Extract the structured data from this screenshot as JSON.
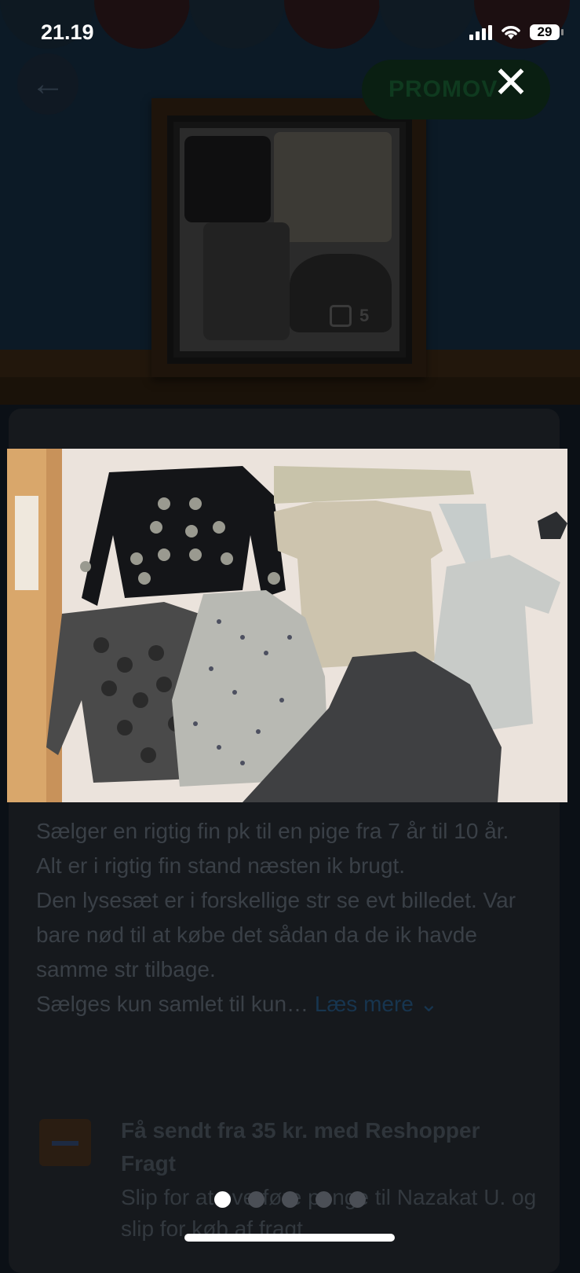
{
  "status_bar": {
    "time": "21.19",
    "battery": "29"
  },
  "header": {
    "back_icon": "arrow-left-icon",
    "promo_label": "PROMOV",
    "close_icon": "close-icon"
  },
  "listing": {
    "image_count": "5",
    "description_lines": [
      "Sælger en rigtig fin pk til en pige fra 7 år til 10 år.",
      "Alt er i rigtig fin stand næsten ik brugt.",
      "Den lysesæt er i forskellige str se evt billedet. Var bare nød til at købe det sådan da de ik havde samme str tilbage.",
      "Sælges kun samlet til kun…"
    ],
    "read_more": "Læs mere",
    "shipping_title": "Få sendt fra 35 kr. med Reshopper Fragt",
    "shipping_desc": "Slip for at overføre penge til Nazakat U. og slip for køb af fragt"
  },
  "viewer": {
    "page_count": 5,
    "active_index": 0
  },
  "colors": {
    "dim_bg": "#0b1016",
    "card_bg": "#16191d",
    "link": "#17354f",
    "dot_active": "#ffffff",
    "dot_inactive": "#4b4f56"
  }
}
